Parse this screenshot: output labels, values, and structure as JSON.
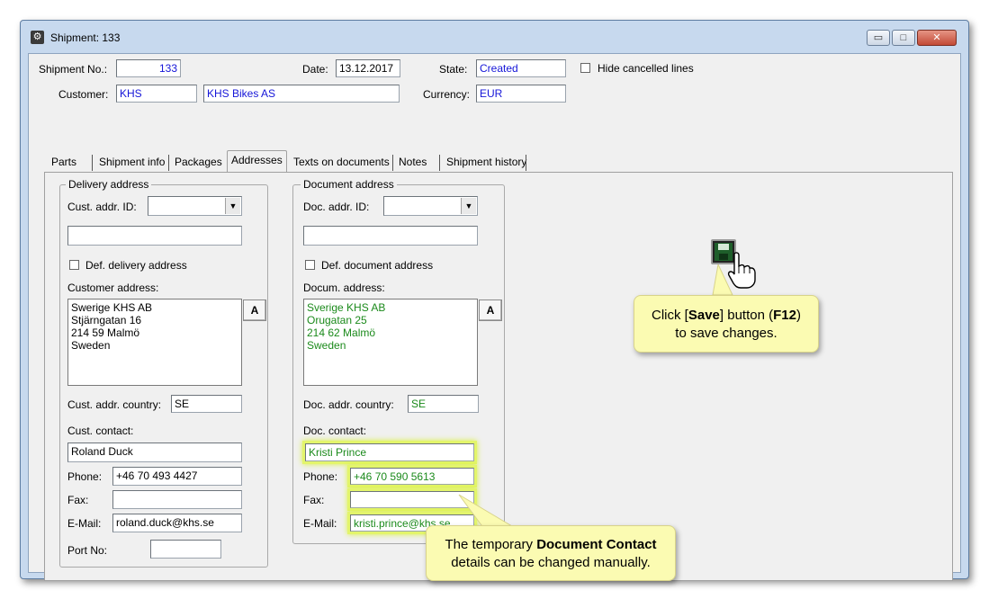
{
  "window": {
    "title": "Shipment: 133",
    "icon": "gear-icon",
    "minimize_glyph": "▭",
    "maximize_glyph": "□",
    "close_glyph": "✕"
  },
  "header": {
    "shipment_no_label": "Shipment No.:",
    "shipment_no_value": "133",
    "date_label": "Date:",
    "date_value": "13.12.2017",
    "state_label": "State:",
    "state_value": "Created",
    "hide_cancelled_label": "Hide cancelled lines",
    "customer_label": "Customer:",
    "customer_code": "KHS",
    "customer_name": "KHS Bikes AS",
    "currency_label": "Currency:",
    "currency_value": "EUR"
  },
  "tabs": [
    {
      "label": "Parts"
    },
    {
      "label": "Shipment info"
    },
    {
      "label": "Packages"
    },
    {
      "label": "Addresses"
    },
    {
      "label": "Texts on documents"
    },
    {
      "label": "Notes"
    },
    {
      "label": "Shipment history"
    }
  ],
  "active_tab": "Addresses",
  "delivery": {
    "group_title": "Delivery address",
    "addr_id_label": "Cust. addr. ID:",
    "addr_id_value": "",
    "line_value": "",
    "default_checkbox_label": "Def. delivery address",
    "address_label": "Customer address:",
    "address_lines": [
      "Swerige KHS AB",
      "Stjärngatan 16",
      "214 59 Malmö",
      "Sweden"
    ],
    "a_button": "A",
    "country_label": "Cust. addr. country:",
    "country_value": "SE",
    "contact_label": "Cust. contact:",
    "contact_value": "Roland Duck",
    "phone_label": "Phone:",
    "phone_value": "+46 70 493 4427",
    "fax_label": "Fax:",
    "fax_value": "",
    "email_label": "E-Mail:",
    "email_value": "roland.duck@khs.se",
    "port_label": "Port No:",
    "port_value": ""
  },
  "document": {
    "group_title": "Document address",
    "addr_id_label": "Doc. addr. ID:",
    "addr_id_value": "",
    "line_value": "",
    "default_checkbox_label": "Def. document address",
    "address_label": "Docum. address:",
    "address_lines": [
      "Sverige KHS AB",
      "Orugatan 25",
      "214 62 Malmö",
      "Sweden"
    ],
    "a_button": "A",
    "country_label": "Doc. addr. country:",
    "country_value": "SE",
    "contact_label": "Doc. contact:",
    "contact_value": "Kristi Prince",
    "phone_label": "Phone:",
    "phone_value": "+46 70 590 5613",
    "fax_label": "Fax:",
    "fax_value": "",
    "email_label": "E-Mail:",
    "email_value": "kristi.prince@khs.se"
  },
  "callouts": {
    "save_pre": "Click [",
    "save_bold1": "Save",
    "save_mid": "] button (",
    "save_bold2": "F12",
    "save_post": ")",
    "save_line2": "to save changes.",
    "contact_line1_pre": "The temporary ",
    "contact_line1_bold": "Document Contact",
    "contact_line2": "details can be changed manually."
  },
  "colors": {
    "highlight": "#e3f56b",
    "callout_bg": "#fbfbb2",
    "blue_text": "#1515d8",
    "green_text": "#1b8a1b"
  }
}
